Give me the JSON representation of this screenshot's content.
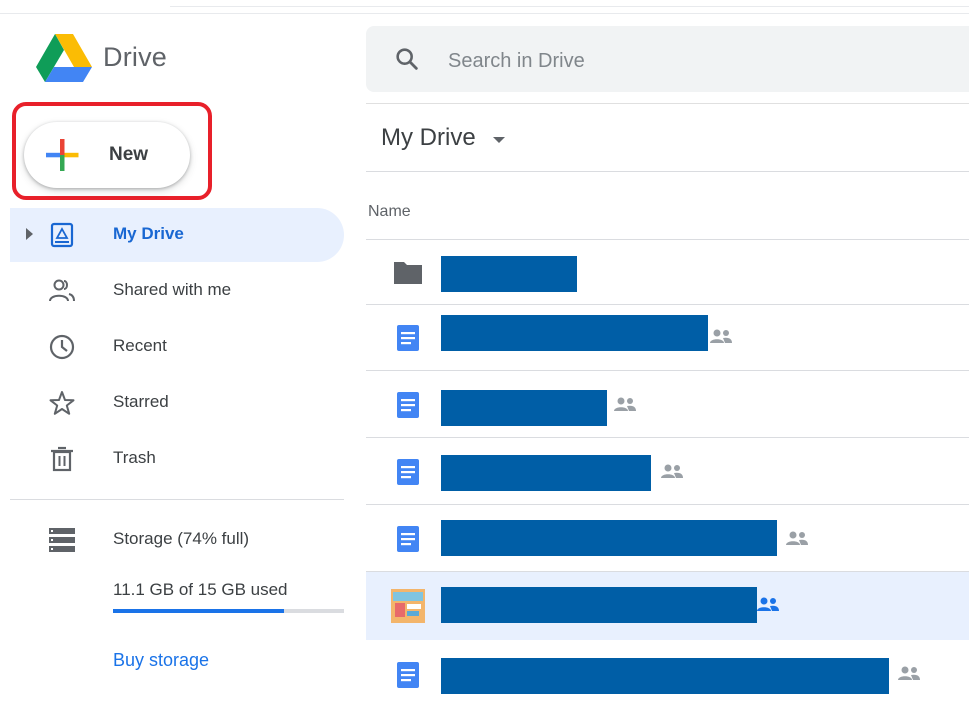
{
  "app": {
    "name": "Drive",
    "logo_icon": "google-drive-logo"
  },
  "search": {
    "placeholder": "Search in Drive",
    "icon": "search-icon"
  },
  "new_button": {
    "label": "New",
    "icon": "plus-icon",
    "highlight_color": "#e8202a"
  },
  "sidebar": {
    "items": [
      {
        "label": "My Drive",
        "icon": "my-drive-icon",
        "active": true
      },
      {
        "label": "Shared with me",
        "icon": "shared-people-icon",
        "active": false
      },
      {
        "label": "Recent",
        "icon": "clock-icon",
        "active": false
      },
      {
        "label": "Starred",
        "icon": "star-icon",
        "active": false
      },
      {
        "label": "Trash",
        "icon": "trash-icon",
        "active": false
      }
    ],
    "storage": {
      "label": "Storage (74% full)",
      "used": "11.1 GB of 15 GB used",
      "fraction_used": 0.74,
      "buy_label": "Buy storage",
      "icon": "storage-icon"
    }
  },
  "main": {
    "title": "My Drive",
    "column_header": "Name",
    "files": [
      {
        "type": "folder",
        "icon": "folder-icon",
        "shared": false,
        "selected": false,
        "name_redacted": true
      },
      {
        "type": "document",
        "icon": "docs-icon",
        "shared": true,
        "selected": false,
        "name_redacted": true
      },
      {
        "type": "document",
        "icon": "docs-icon",
        "shared": true,
        "selected": false,
        "name_redacted": true
      },
      {
        "type": "document",
        "icon": "docs-icon",
        "shared": true,
        "selected": false,
        "name_redacted": true
      },
      {
        "type": "document",
        "icon": "docs-icon",
        "shared": true,
        "selected": false,
        "name_redacted": true
      },
      {
        "type": "image",
        "icon": "image-thumbnail-icon",
        "shared": true,
        "selected": true,
        "name_redacted": true
      },
      {
        "type": "document",
        "icon": "docs-icon",
        "shared": true,
        "selected": false,
        "name_redacted": true
      }
    ]
  },
  "colors": {
    "accent": "#1a73e8",
    "active_nav_bg": "#e8f0fe",
    "redaction": "#005ea6"
  }
}
